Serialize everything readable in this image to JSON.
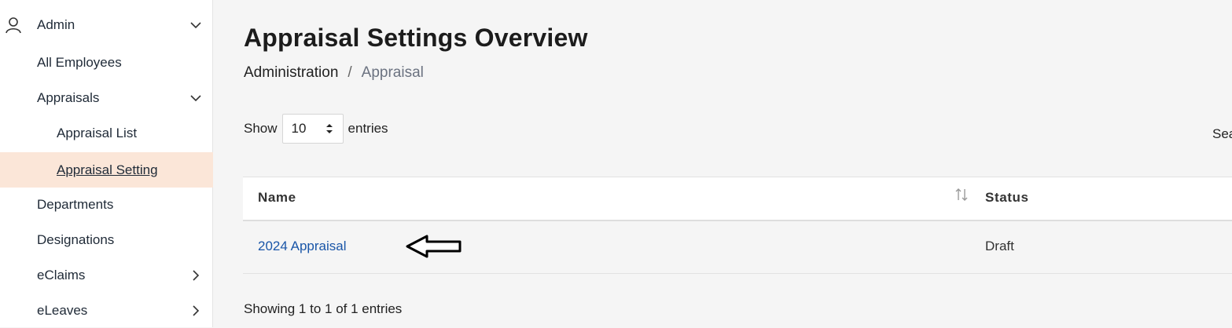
{
  "sidebar": {
    "section": {
      "label": "Admin",
      "icon": "user-icon"
    },
    "items": [
      {
        "label": "All Employees"
      },
      {
        "label": "Appraisals"
      },
      {
        "label": "Appraisal List"
      },
      {
        "label": "Appraisal Setting"
      },
      {
        "label": "Departments"
      },
      {
        "label": "Designations"
      },
      {
        "label": "eClaims"
      },
      {
        "label": "eLeaves"
      }
    ]
  },
  "header": {
    "title": "Appraisal Settings Overview",
    "breadcrumb": {
      "root": "Administration",
      "separator": "/",
      "current": "Appraisal"
    }
  },
  "controls": {
    "show_label": "Show",
    "page_length": "10",
    "entries_label": "entries",
    "search_label": "Sea"
  },
  "table": {
    "columns": [
      "Name",
      "Status"
    ],
    "rows": [
      {
        "name": "2024 Appraisal",
        "status": "Draft"
      }
    ],
    "info": "Showing 1 to 1 of 1 entries"
  },
  "colors": {
    "accent_active_bg": "#fbe6d8",
    "link": "#1a56a8"
  }
}
